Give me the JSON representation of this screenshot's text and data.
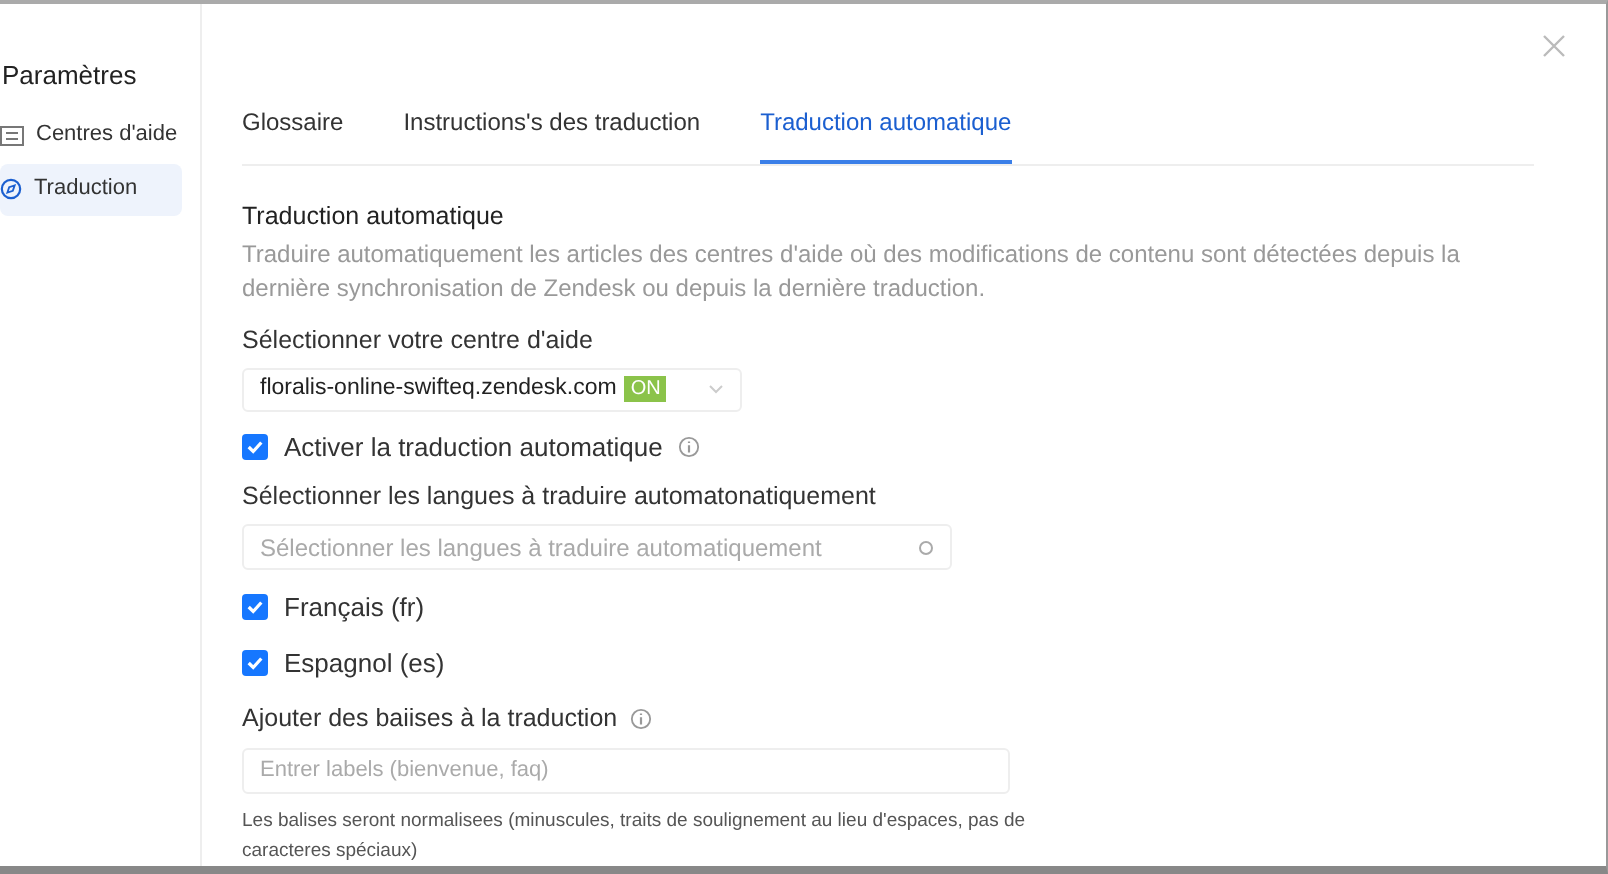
{
  "sidebar": {
    "title": "Paramètres",
    "items": [
      {
        "label": "Centres d'aide",
        "selected": false
      },
      {
        "label": "Traduction",
        "selected": true
      }
    ]
  },
  "tabs": [
    {
      "label": "Glossaire",
      "selected": false
    },
    {
      "label": "Instructions's des traduction",
      "selected": false
    },
    {
      "label": "Traduction automatique",
      "selected": true
    }
  ],
  "section": {
    "title": "Traduction automatique",
    "description": "Traduire automatiquement les articles des centres d'aide où des modifications de contenu sont détectées depuis la dernière synchronisation de Zendesk ou depuis la dernière traduction."
  },
  "help_center": {
    "label": "Sélectionner votre centre d'aide",
    "value": "floralis-online-swifteq.zendesk.com",
    "badge": "ON"
  },
  "auto_translate": {
    "label": "Activer la traduction automatique",
    "checked": true
  },
  "languages": {
    "label": "Sélectionner les langues à traduire automatonatiquement",
    "placeholder": "Sélectionner les langues à traduire automatiquement",
    "options": [
      {
        "label": "Français (fr)",
        "checked": true
      },
      {
        "label": "Espagnol (es)",
        "checked": true
      }
    ]
  },
  "tags": {
    "label": "Ajouter des baiises à la traduction",
    "placeholder": "Entrer labels (bienvenue, faq)",
    "help": "Les balises seront normalisees (minuscules, traits de soulignement au lieu d'espaces, pas de caracteres spéciaux)"
  }
}
